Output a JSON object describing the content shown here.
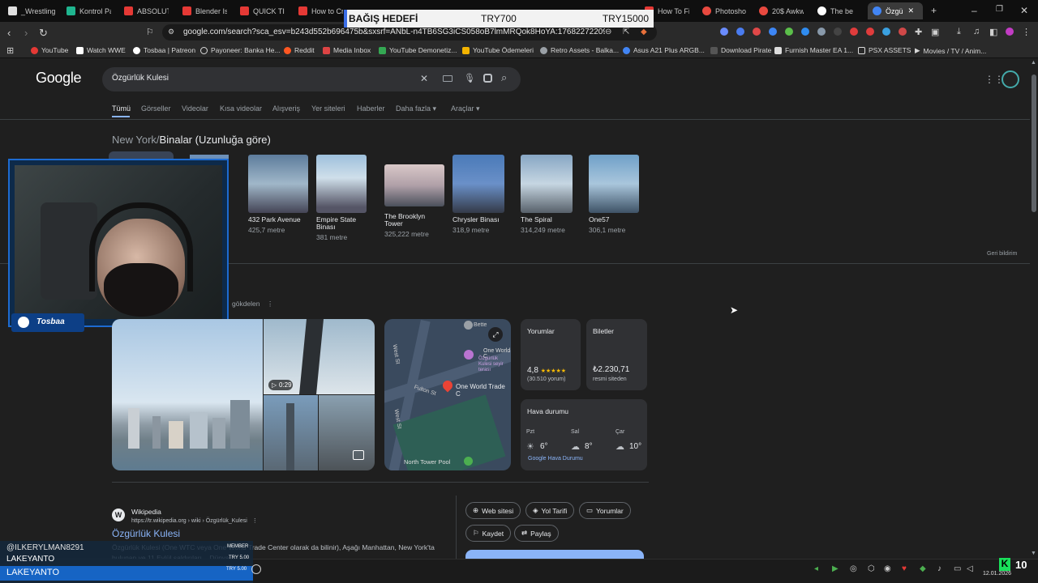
{
  "tabs": [
    {
      "label": "_Wrestling",
      "color": "#e0e0e0"
    },
    {
      "label": "Kontrol Pa",
      "color": "#1fb58f"
    },
    {
      "label": "ABSOLUTE",
      "color": "#e53935"
    },
    {
      "label": "Blender Is",
      "color": "#e53935"
    },
    {
      "label": "QUICK TIP",
      "color": "#e53935"
    },
    {
      "label": "How to Cr",
      "color": "#e53935"
    },
    {
      "label": "How To Fi",
      "color": "#e53935"
    },
    {
      "label": "Photosho",
      "color": "#e8493f"
    },
    {
      "label": "20$ Awkw",
      "color": "#e8493f"
    },
    {
      "label": "The be",
      "color": "#ffffff"
    },
    {
      "label": "Özgü",
      "color": "#4285f4"
    }
  ],
  "url": "google.com/search?sca_esv=b243d552b696475b&sxsrf=ANbL-n4TB6SG3iCS058oB7lmMRQok8HoYA:1768227220981&q=...",
  "bookmarks": [
    "YouTube",
    "Watch WWE",
    "Tosbaa | Patreon",
    "Payoneer: Banka He...",
    "Reddit",
    "Media Inbox",
    "YouTube Demonetiz...",
    "YouTube Ödemeleri",
    "Retro Assets - Balka...",
    "Asus A21 Plus ARGB...",
    "Download Pirate",
    "Furnish Master EA 1...",
    "PSX ASSETS",
    "Movies / TV / Anim..."
  ],
  "donation": {
    "label": "BAĞIŞ HEDEFİ",
    "current": "TRY700",
    "goal": "TRY15000"
  },
  "google": {
    "logo": "Google",
    "query": "Özgürlük Kulesi",
    "nav": [
      "Tümü",
      "Görseller",
      "Videolar",
      "Kısa videolar",
      "Alışveriş",
      "Yer siteleri",
      "Haberler",
      "Daha fazla",
      "Araçlar"
    ],
    "breadcrumb_prefix": "New York/",
    "breadcrumb_title": "Binalar (Uzunluğa göre)",
    "buildings": [
      {
        "name": "432 Park Avenue",
        "height": "425,7 metre"
      },
      {
        "name": "Empire State Binası",
        "height": "381 metre"
      },
      {
        "name": "The Brooklyn Tower",
        "height": "325,222 metre"
      },
      {
        "name": "Chrysler Binası",
        "height": "318,9 metre"
      },
      {
        "name": "The Spiral",
        "height": "314,249 metre"
      },
      {
        "name": "One57",
        "height": "306,1 metre"
      }
    ],
    "feedback": "Geri bildirim",
    "kg_subtitle": "gökdelen",
    "video_duration": "0:29",
    "map_labels": [
      "Bette",
      "One World C",
      "Özgürlük Kulesi seyir terası",
      "One World Trade C",
      "West St",
      "Fulton St",
      "West St",
      "North Tower Pool"
    ],
    "reviews": {
      "title": "Yorumlar",
      "rating": "4,8",
      "stars": "★★★★★",
      "count": "(30.510 yorum)"
    },
    "tickets": {
      "title": "Biletler",
      "price": "₺2.230,71",
      "source": "resmi siteden"
    },
    "weather": {
      "title": "Hava durumu",
      "days": [
        {
          "d": "Pzt",
          "t": "6°"
        },
        {
          "d": "Sal",
          "t": "8°"
        },
        {
          "d": "Çar",
          "t": "10°"
        }
      ],
      "link": "Google Hava Durumu"
    },
    "result": {
      "site": "Wikipedia",
      "url": "https://tr.wikipedia.org › wiki › Özgürlük_Kulesi",
      "title": "Özgürlük Kulesi",
      "snippet": "Özgürlük Kulesi (One WTC veya One World Trade Center olarak da bilinir), Aşağı Manhattan, New York'ta bulunan ve 11 Eylül saldırıları... Dünya..."
    },
    "actions": [
      "Web sitesi",
      "Yol Tarifi",
      "Yorumlar",
      "Kaydet",
      "Paylaş"
    ]
  },
  "stream": {
    "name": "Tosbaa",
    "chat": [
      "@ILKERYLMAN8291",
      "LAKEYANTO",
      "LAKEYANTO"
    ],
    "chat_badges": [
      "MEMBER",
      "TRY 5.00",
      "TRY 5.00"
    ]
  },
  "taskbar": {
    "date": "12.01.2026",
    "score": "10"
  }
}
